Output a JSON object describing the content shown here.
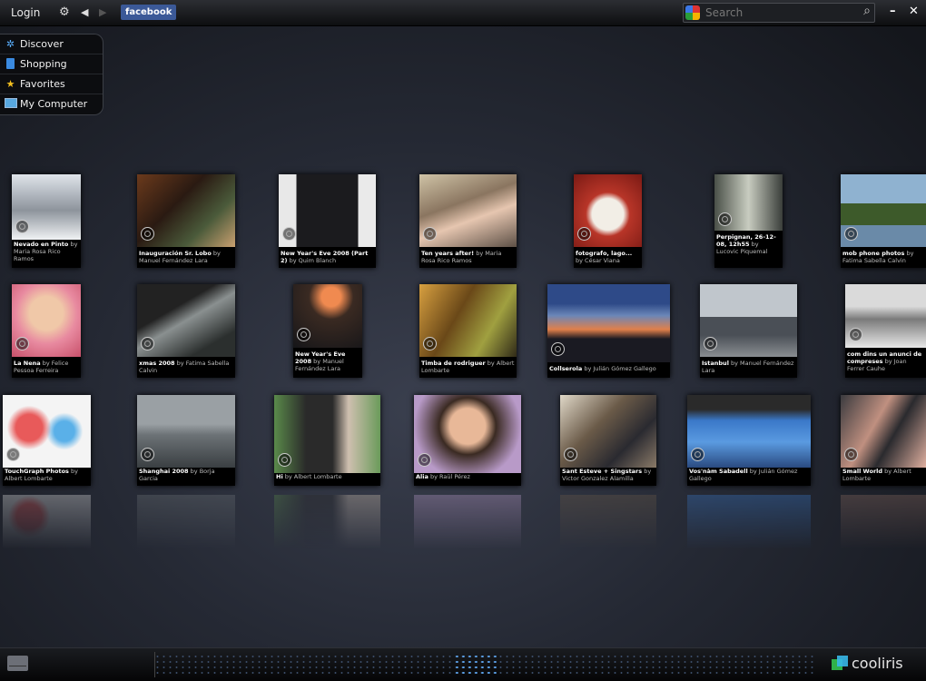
{
  "topbar": {
    "login": "Login",
    "facebook": "facebook",
    "search_placeholder": "Search"
  },
  "menu": [
    {
      "label": "Discover",
      "icon": "discover-icon"
    },
    {
      "label": "Shopping",
      "icon": "shopping-bag-icon"
    },
    {
      "label": "Favorites",
      "icon": "star-icon"
    },
    {
      "label": "My Computer",
      "icon": "computer-icon"
    }
  ],
  "photos": [
    {
      "title": "Nevado en Pinto",
      "by": "by Maria Rosa Rico Ramos"
    },
    {
      "title": "Inauguración Sr. Lobo",
      "by": "by Manuel Fernández Lara"
    },
    {
      "title": "New Year's Eve 2008 (Part 2)",
      "by": "by Quim Blanch"
    },
    {
      "title": "Ten years after!",
      "by": "by Maria Rosa Rico Ramos"
    },
    {
      "title": "fotografo, lago...",
      "by": "by César Viana"
    },
    {
      "title": "Perpignan, 26-12-08, 12h55",
      "by": "by Lucovic Piquemal"
    },
    {
      "title": "mob phone photos",
      "by": "by Fatima Sabella Calvin"
    },
    {
      "title": "La Nena",
      "by": "by Felice Pessoa Ferreira"
    },
    {
      "title": "xmas 2008",
      "by": "by Fatima Sabella Calvin"
    },
    {
      "title": "New Year's Eve 2008",
      "by": "by Manuel Fernández Lara"
    },
    {
      "title": "Timba de rodriguer",
      "by": "by Albert Lombarte"
    },
    {
      "title": "Collserola",
      "by": "by Julián Gómez Gallego"
    },
    {
      "title": "Istanbul",
      "by": "by Manuel Fernández Lara"
    },
    {
      "title": "com dins un anunci de compreses",
      "by": "by Joan Ferrer Cauhe"
    },
    {
      "title": "TouchGraph Photos",
      "by": "by Albert Lombarte"
    },
    {
      "title": "Shanghai 2008",
      "by": "by Borja Garcia"
    },
    {
      "title": "Hi",
      "by": "by Albert Lombarte"
    },
    {
      "title": "Alia",
      "by": "by Raül Pérez"
    },
    {
      "title": "Sant Esteve + Singstars",
      "by": "by Victor Gonzalez Alamilla"
    },
    {
      "title": "Vos'nàm Sabadell",
      "by": "by Julián Gómez Gallego"
    },
    {
      "title": "Small World",
      "by": "by Albert Lombarte"
    }
  ],
  "brand": "cooliris"
}
